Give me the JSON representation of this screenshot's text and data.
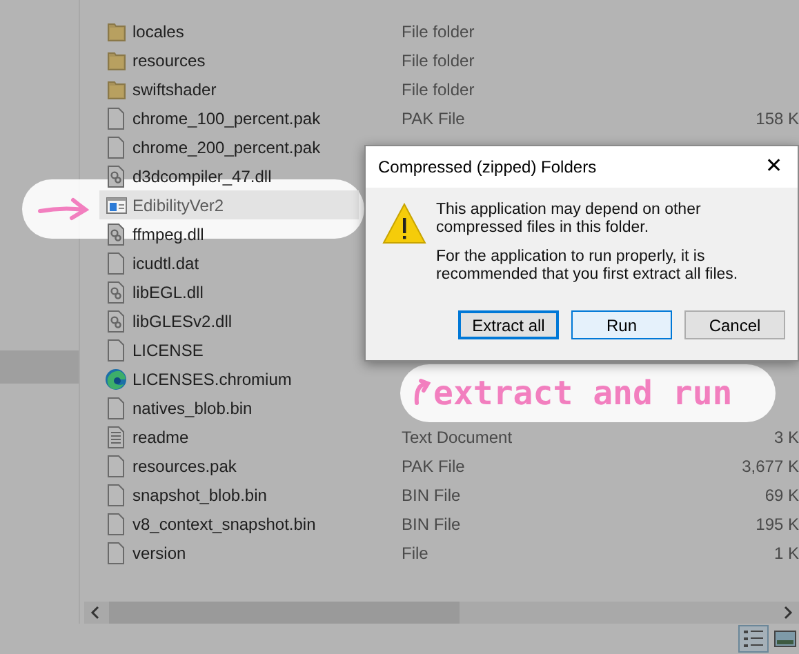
{
  "files": [
    {
      "name": "locales",
      "kind": "folder",
      "type": "File folder",
      "selected": false
    },
    {
      "name": "resources",
      "kind": "folder",
      "type": "File folder",
      "selected": false
    },
    {
      "name": "swiftshader",
      "kind": "folder",
      "type": "File folder",
      "selected": false
    },
    {
      "name": "chrome_100_percent.pak",
      "kind": "file",
      "type": "PAK File",
      "size": "158 K",
      "selected": false
    },
    {
      "name": "chrome_200_percent.pak",
      "kind": "file",
      "selected": false
    },
    {
      "name": "d3dcompiler_47.dll",
      "kind": "dll",
      "selected": false
    },
    {
      "name": "EdibilityVer2",
      "kind": "app",
      "selected": true
    },
    {
      "name": "ffmpeg.dll",
      "kind": "dll",
      "selected": false
    },
    {
      "name": "icudtl.dat",
      "kind": "file",
      "selected": false
    },
    {
      "name": "libEGL.dll",
      "kind": "dll",
      "selected": false
    },
    {
      "name": "libGLESv2.dll",
      "kind": "dll",
      "selected": false
    },
    {
      "name": "LICENSE",
      "kind": "file",
      "selected": false
    },
    {
      "name": "LICENSES.chromium",
      "kind": "browser",
      "selected": false
    },
    {
      "name": "natives_blob.bin",
      "kind": "file",
      "selected": false
    },
    {
      "name": "readme",
      "kind": "text",
      "type": "Text Document",
      "size": "3 K",
      "selected": false
    },
    {
      "name": "resources.pak",
      "kind": "file",
      "type": "PAK File",
      "size": "3,677 K",
      "selected": false
    },
    {
      "name": "snapshot_blob.bin",
      "kind": "file",
      "type": "BIN File",
      "size": "69 K",
      "selected": false
    },
    {
      "name": "v8_context_snapshot.bin",
      "kind": "file",
      "type": "BIN File",
      "size": "195 K",
      "selected": false
    },
    {
      "name": "version",
      "kind": "file",
      "type": "File",
      "size": "1 K",
      "selected": false
    }
  ],
  "dialog": {
    "title": "Compressed (zipped) Folders",
    "close": "✕",
    "message": "This application may depend on other compressed files in this folder.",
    "advice": "For the application to run properly, it is recommended that you first extract all files.",
    "buttons": [
      {
        "label": "Extract all",
        "selected": true
      },
      {
        "label": "Run",
        "selected": false
      },
      {
        "label": "Cancel",
        "selected": false
      }
    ]
  },
  "annotation": {
    "text": "extract and run"
  }
}
